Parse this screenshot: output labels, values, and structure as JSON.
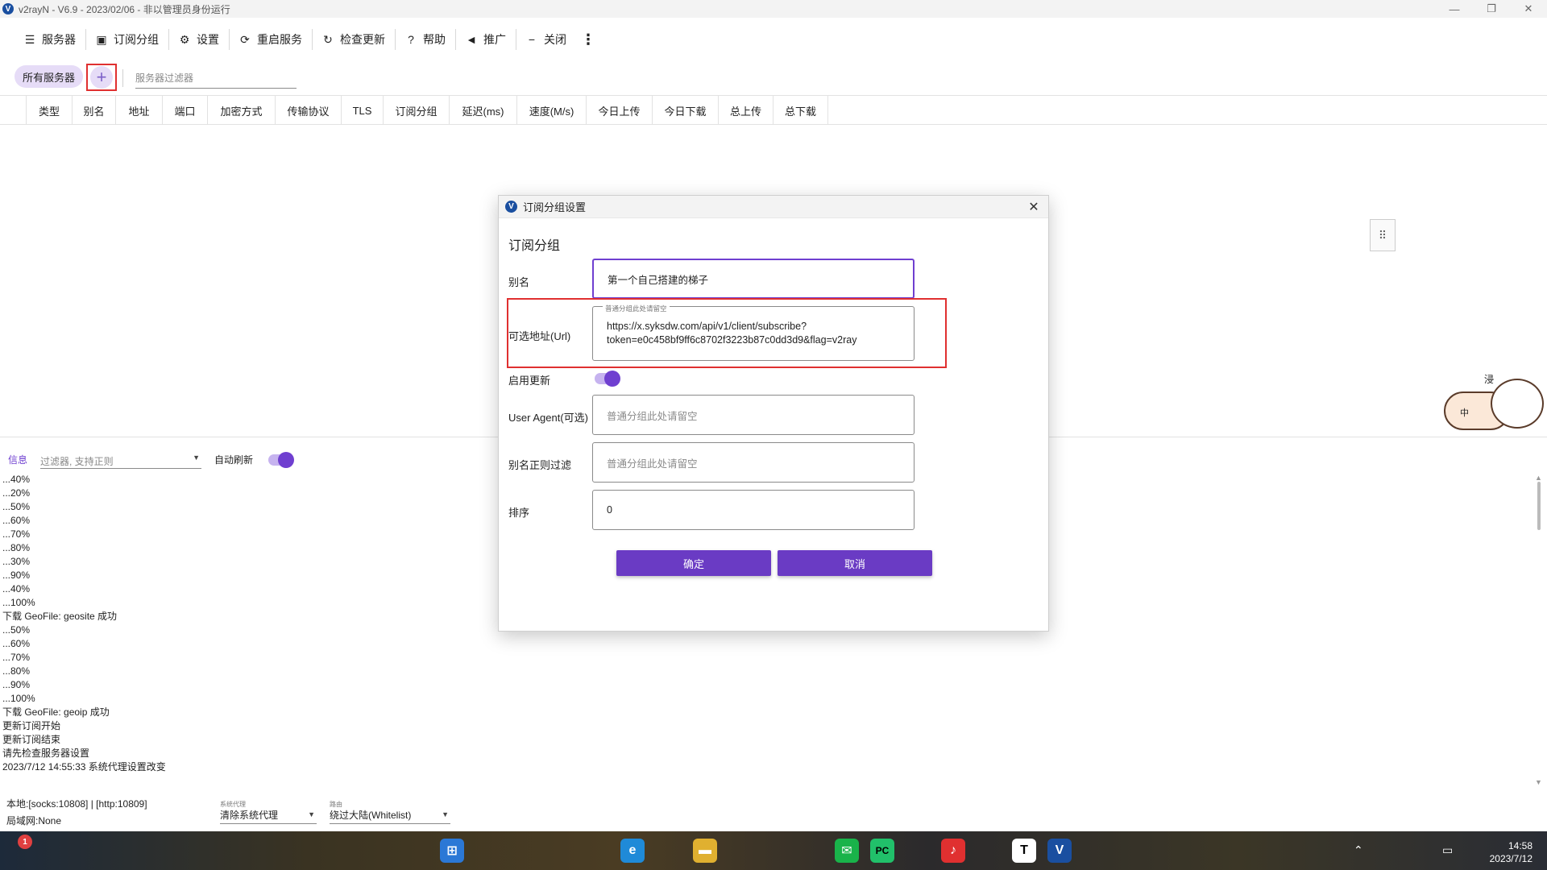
{
  "window": {
    "title": "v2rayN - V6.9 - 2023/02/06 - 非以管理员身份运行",
    "minimize": "—",
    "maximize": "❐",
    "close": "✕"
  },
  "toolbar": {
    "items": [
      {
        "label": "服务器",
        "icon": "server-icon"
      },
      {
        "label": "订阅分组",
        "icon": "subscription-icon"
      },
      {
        "label": "设置",
        "icon": "gear-icon"
      },
      {
        "label": "重启服务",
        "icon": "restart-icon"
      },
      {
        "label": "检查更新",
        "icon": "update-icon"
      },
      {
        "label": "帮助",
        "icon": "help-icon"
      },
      {
        "label": "推广",
        "icon": "megaphone-icon"
      },
      {
        "label": "关闭",
        "icon": "minus-icon"
      }
    ],
    "more": "⋮"
  },
  "filter_row": {
    "all_servers": "所有服务器",
    "add": "+",
    "server_filter_placeholder": "服务器过滤器"
  },
  "grid": {
    "columns": [
      "类型",
      "别名",
      "地址",
      "端口",
      "加密方式",
      "传输协议",
      "TLS",
      "订阅分组",
      "延迟(ms)",
      "速度(M/s)",
      "今日上传",
      "今日下载",
      "总上传",
      "总下载"
    ]
  },
  "dialog": {
    "title": "订阅分组设置",
    "heading": "订阅分组",
    "close": "✕",
    "alias_label": "别名",
    "alias_value": "第一个自己搭建的梯子",
    "url_label": "可选地址(Url)",
    "url_legend": "普通分组此处请留空",
    "url_line1": "https://x.syksdw.com/api/v1/client/subscribe?",
    "url_line2": "token=e0c458bf9ff6c8702f3223b87c0dd3d9&flag=v2ray",
    "enable_update_label": "启用更新",
    "enable_update": true,
    "ua_label": "User Agent(可选)",
    "ua_placeholder": "普通分组此处请留空",
    "alias_filter_label": "别名正则过滤",
    "alias_filter_placeholder": "普通分组此处请留空",
    "sort_label": "排序",
    "sort_value": "0",
    "ok": "确定",
    "cancel": "取消"
  },
  "log": {
    "tab": "信息",
    "filter_placeholder": "过滤器, 支持正则",
    "auto_refresh_label": "自动刷新",
    "auto_refresh": true,
    "lines": [
      "...40%",
      "...20%",
      "...50%",
      "...60%",
      "...70%",
      "...80%",
      "...30%",
      "...90%",
      "...40%",
      "...100%",
      "下载 GeoFile: geosite 成功",
      "...50%",
      "...60%",
      "...70%",
      "...80%",
      "...90%",
      "...100%",
      "下载 GeoFile: geoip 成功",
      "更新订阅开始",
      "更新订阅结束",
      "请先检查服务器设置",
      "2023/7/12 14:55:33 系统代理设置改变"
    ]
  },
  "status": {
    "local": "本地:[socks:10808] | [http:10809]",
    "lan": "局域网:None",
    "sysproxy_caption": "系统代理",
    "sysproxy_value": "清除系统代理",
    "routing_caption": "路由",
    "routing_value": "绕过大陆(Whitelist)"
  },
  "taskbar": {
    "time": "14:58",
    "date": "2023/7/12",
    "notification_badge": "1"
  },
  "mascot": {
    "label": "中",
    "corner": "浸"
  },
  "colors": {
    "accent": "#6a3bc4",
    "highlight_red": "#e03030",
    "chip_bg": "#e6dcf7"
  }
}
